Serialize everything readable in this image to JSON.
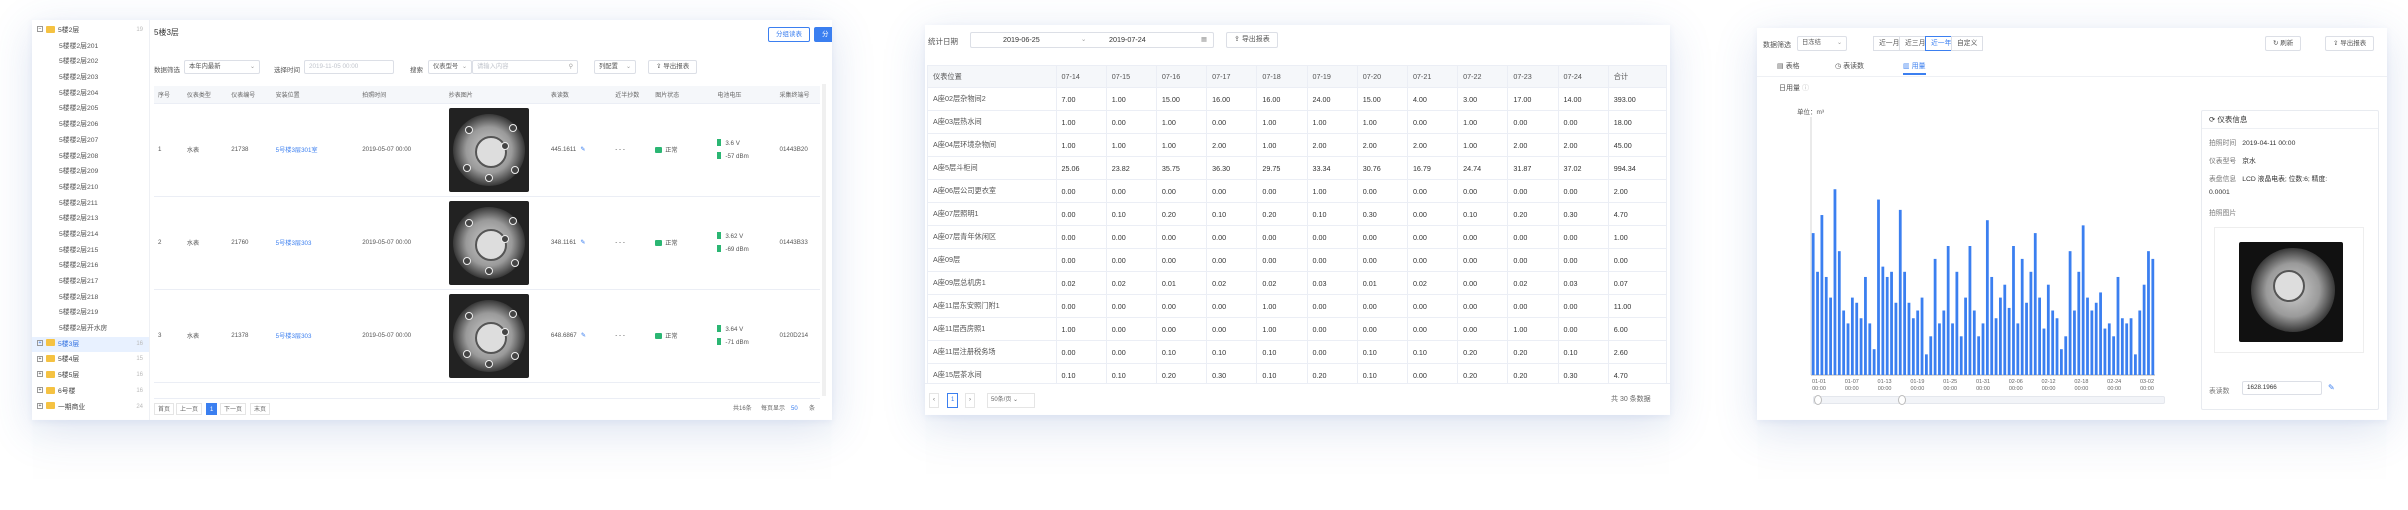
{
  "panel1": {
    "tree_items": [
      {
        "label": "5楼2层",
        "type": "group-open",
        "count": "19"
      },
      {
        "label": "5楼楼2层201",
        "type": "leaf"
      },
      {
        "label": "5楼楼2层202",
        "type": "leaf"
      },
      {
        "label": "5楼楼2层203",
        "type": "leaf"
      },
      {
        "label": "5楼楼2层204",
        "type": "leaf"
      },
      {
        "label": "5楼楼2层205",
        "type": "leaf"
      },
      {
        "label": "5楼楼2层206",
        "type": "leaf"
      },
      {
        "label": "5楼楼2层207",
        "type": "leaf"
      },
      {
        "label": "5楼楼2层208",
        "type": "leaf"
      },
      {
        "label": "5楼楼2层209",
        "type": "leaf"
      },
      {
        "label": "5楼楼2层210",
        "type": "leaf"
      },
      {
        "label": "5楼楼2层211",
        "type": "leaf"
      },
      {
        "label": "5楼楼2层213",
        "type": "leaf"
      },
      {
        "label": "5楼楼2层214",
        "type": "leaf"
      },
      {
        "label": "5楼楼2层215",
        "type": "leaf"
      },
      {
        "label": "5楼楼2层216",
        "type": "leaf"
      },
      {
        "label": "5楼楼2层217",
        "type": "leaf"
      },
      {
        "label": "5楼楼2层218",
        "type": "leaf"
      },
      {
        "label": "5楼楼2层219",
        "type": "leaf"
      },
      {
        "label": "5楼楼2层开水房",
        "type": "leaf"
      },
      {
        "label": "5楼3层",
        "type": "group",
        "count": "16",
        "active": true
      },
      {
        "label": "5楼4层",
        "type": "group",
        "count": "15"
      },
      {
        "label": "5楼5层",
        "type": "group",
        "count": "16"
      },
      {
        "label": "6号楼",
        "type": "group",
        "count": "16"
      },
      {
        "label": "一期商业",
        "type": "group",
        "count": "24"
      }
    ],
    "title": "5楼3层",
    "btn_group_read": "分组读表",
    "btn_group_param": "分组参数",
    "filter_data_label": "数据筛选",
    "filter_data_value": "本年内最新",
    "filter_time_label": "选择时间",
    "filter_time_placeholder": "2019-11-05 00:00",
    "search_label": "搜索",
    "search_field_value": "仪表型号",
    "search_placeholder": "请输入内容",
    "alarm_value": "列配置",
    "export_label": "导出报表",
    "columns": [
      "序号",
      "仪表类型",
      "仪表编号",
      "安装位置",
      "拍照时间",
      "抄表图片",
      "表读数",
      "近半抄数",
      "图片状态",
      "电池电压",
      "采集终端号"
    ],
    "rows": [
      {
        "idx": "1",
        "type": "水表",
        "no": "21738",
        "loc": "5号楼3层301室",
        "time": "2019-05-07 00:00",
        "reading": "445.1611",
        "prev": "- - -",
        "status": "正常",
        "volt": "3.6 V",
        "rssi": "-57 dBm",
        "term": "01443B20"
      },
      {
        "idx": "2",
        "type": "水表",
        "no": "21760",
        "loc": "5号楼3层303",
        "time": "2019-05-07 00:00",
        "reading": "348.1161",
        "prev": "- - -",
        "status": "正常",
        "volt": "3.62 V",
        "rssi": "-69 dBm",
        "term": "01443B33"
      },
      {
        "idx": "3",
        "type": "水表",
        "no": "21378",
        "loc": "5号楼3层303",
        "time": "2019-05-07 00:00",
        "reading": "648.6867",
        "prev": "- - -",
        "status": "正常",
        "volt": "3.64 V",
        "rssi": "-71 dBm",
        "term": "0120D214"
      }
    ],
    "pager": {
      "first": "首页",
      "prev": "上一页",
      "cur": "1",
      "next": "下一页",
      "last": "末页",
      "total": "共16条",
      "per_label": "每页显示",
      "per_value": "50",
      "unit": "条"
    }
  },
  "panel2": {
    "stat_date_label": "统计日期",
    "date_from": "2019-06-25",
    "date_to": "2019-07-24",
    "export_label": "导出报表",
    "columns": [
      "仪表位置",
      "07-14",
      "07-15",
      "07-16",
      "07-17",
      "07-18",
      "07-19",
      "07-20",
      "07-21",
      "07-22",
      "07-23",
      "07-24",
      "合计"
    ],
    "rows": [
      [
        "A座02层杂物间2",
        "7.00",
        "1.00",
        "15.00",
        "16.00",
        "16.00",
        "24.00",
        "15.00",
        "4.00",
        "3.00",
        "17.00",
        "14.00",
        "393.00"
      ],
      [
        "A座03层热水间",
        "1.00",
        "0.00",
        "1.00",
        "0.00",
        "1.00",
        "1.00",
        "1.00",
        "0.00",
        "1.00",
        "0.00",
        "0.00",
        "18.00"
      ],
      [
        "A座04层环境杂物间",
        "1.00",
        "1.00",
        "1.00",
        "2.00",
        "1.00",
        "2.00",
        "2.00",
        "2.00",
        "1.00",
        "2.00",
        "2.00",
        "45.00"
      ],
      [
        "A座5层斗柜间",
        "25.06",
        "23.82",
        "35.75",
        "36.30",
        "29.75",
        "33.34",
        "30.76",
        "16.79",
        "24.74",
        "31.87",
        "37.02",
        "994.34"
      ],
      [
        "A座06层公司更衣室",
        "0.00",
        "0.00",
        "0.00",
        "0.00",
        "0.00",
        "1.00",
        "0.00",
        "0.00",
        "0.00",
        "0.00",
        "0.00",
        "2.00"
      ],
      [
        "A座07层照明1",
        "0.00",
        "0.10",
        "0.20",
        "0.10",
        "0.20",
        "0.10",
        "0.30",
        "0.00",
        "0.10",
        "0.20",
        "0.30",
        "4.70"
      ],
      [
        "A座07层青年休闲区",
        "0.00",
        "0.00",
        "0.00",
        "0.00",
        "0.00",
        "0.00",
        "0.00",
        "0.00",
        "0.00",
        "0.00",
        "0.00",
        "1.00"
      ],
      [
        "A座09层",
        "0.00",
        "0.00",
        "0.00",
        "0.00",
        "0.00",
        "0.00",
        "0.00",
        "0.00",
        "0.00",
        "0.00",
        "0.00",
        "0.00"
      ],
      [
        "A座09层总机房1",
        "0.02",
        "0.02",
        "0.01",
        "0.02",
        "0.02",
        "0.03",
        "0.01",
        "0.02",
        "0.00",
        "0.02",
        "0.03",
        "0.07"
      ],
      [
        "A座11层东安照门附1",
        "0.00",
        "0.00",
        "0.00",
        "0.00",
        "1.00",
        "0.00",
        "0.00",
        "0.00",
        "0.00",
        "0.00",
        "0.00",
        "11.00"
      ],
      [
        "A座11层西房照1",
        "1.00",
        "0.00",
        "0.00",
        "0.00",
        "1.00",
        "0.00",
        "0.00",
        "0.00",
        "0.00",
        "1.00",
        "0.00",
        "6.00"
      ],
      [
        "A座11层注册税务场",
        "0.00",
        "0.00",
        "0.10",
        "0.10",
        "0.10",
        "0.00",
        "0.10",
        "0.10",
        "0.20",
        "0.20",
        "0.10",
        "2.60"
      ],
      [
        "A座15层茶水间",
        "0.10",
        "0.10",
        "0.20",
        "0.30",
        "0.10",
        "0.20",
        "0.10",
        "0.00",
        "0.20",
        "0.20",
        "0.30",
        "4.70"
      ]
    ],
    "pager": {
      "cur": "1",
      "page_size": "50条/页",
      "total": "共 30 条数据"
    }
  },
  "panel3": {
    "filter_label": "数据筛选",
    "filter_value": "日冻结",
    "range_btns": [
      "近一月",
      "近三月",
      "近一年",
      "自定义"
    ],
    "range_active": 2,
    "refresh_label": "刷新",
    "export_label": "导出报表",
    "tabs": [
      "表格",
      "表读数",
      "用量"
    ],
    "tab_active": 2,
    "sub_label": "日用量",
    "unit_label": "单位：m³",
    "info": {
      "title": "仪表信息",
      "time_label": "拍照时间",
      "time_value": "2019-04-11 00:00",
      "model_label": "仪表型号",
      "model_value": "京水",
      "desc_label": "表盘信息",
      "desc_value": "LCD 液晶电表; 位数:6; 精度:",
      "desc_value2": "0.0001",
      "photo_label": "拍照图片",
      "reading_label": "表读数",
      "reading_value": "1628.1966"
    }
  },
  "chart_data": {
    "type": "bar",
    "x": [
      "01-01 00:00",
      "01-07 00:00",
      "01-13 00:00",
      "01-19 00:00",
      "01-25 00:00",
      "01-31 00:00",
      "02-06 00:00",
      "02-12 00:00",
      "02-18 00:00",
      "02-24 00:00",
      "03-02 00:00"
    ],
    "values": [
      55,
      40,
      62,
      38,
      30,
      72,
      48,
      25,
      20,
      30,
      28,
      22,
      38,
      20,
      10,
      68,
      42,
      38,
      40,
      28,
      64,
      40,
      28,
      22,
      25,
      30,
      8,
      15,
      45,
      20,
      25,
      50,
      20,
      40,
      15,
      30,
      50,
      25,
      15,
      20,
      60,
      38,
      22,
      30,
      35,
      26,
      50,
      20,
      45,
      28,
      40,
      55,
      30,
      18,
      35,
      25,
      22,
      10,
      15,
      48,
      25,
      40,
      58,
      30,
      25,
      28,
      32,
      18,
      20,
      15,
      38,
      22,
      20,
      22,
      8,
      25,
      35,
      48,
      45
    ],
    "ylabel": "单位：m³",
    "color": "#3b7ff0"
  },
  "colors": {
    "accent": "#3b7ff0",
    "ok": "#2bb673"
  }
}
